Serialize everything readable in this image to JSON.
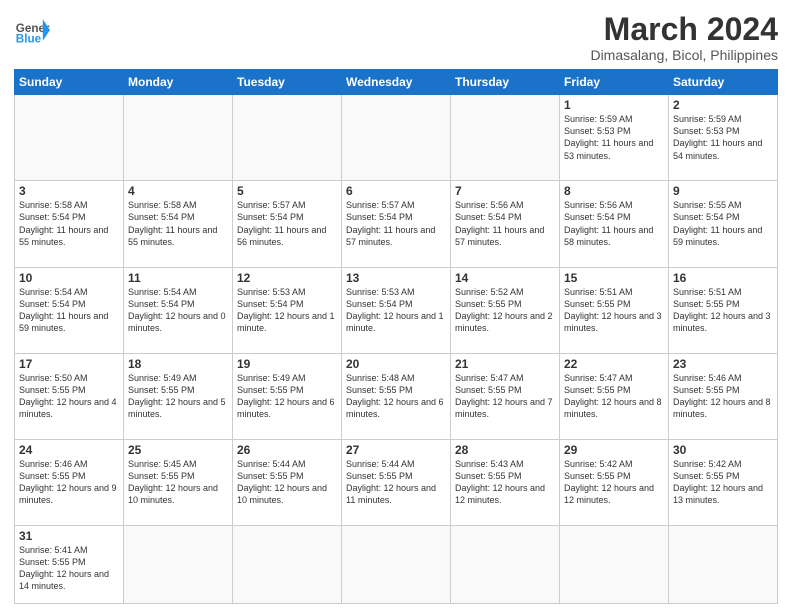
{
  "header": {
    "logo_general": "General",
    "logo_blue": "Blue",
    "month_title": "March 2024",
    "location": "Dimasalang, Bicol, Philippines"
  },
  "weekdays": [
    "Sunday",
    "Monday",
    "Tuesday",
    "Wednesday",
    "Thursday",
    "Friday",
    "Saturday"
  ],
  "rows": [
    [
      {
        "day": "",
        "info": ""
      },
      {
        "day": "",
        "info": ""
      },
      {
        "day": "",
        "info": ""
      },
      {
        "day": "",
        "info": ""
      },
      {
        "day": "",
        "info": ""
      },
      {
        "day": "1",
        "info": "Sunrise: 5:59 AM\nSunset: 5:53 PM\nDaylight: 11 hours\nand 53 minutes."
      },
      {
        "day": "2",
        "info": "Sunrise: 5:59 AM\nSunset: 5:53 PM\nDaylight: 11 hours\nand 54 minutes."
      }
    ],
    [
      {
        "day": "3",
        "info": "Sunrise: 5:58 AM\nSunset: 5:54 PM\nDaylight: 11 hours\nand 55 minutes."
      },
      {
        "day": "4",
        "info": "Sunrise: 5:58 AM\nSunset: 5:54 PM\nDaylight: 11 hours\nand 55 minutes."
      },
      {
        "day": "5",
        "info": "Sunrise: 5:57 AM\nSunset: 5:54 PM\nDaylight: 11 hours\nand 56 minutes."
      },
      {
        "day": "6",
        "info": "Sunrise: 5:57 AM\nSunset: 5:54 PM\nDaylight: 11 hours\nand 57 minutes."
      },
      {
        "day": "7",
        "info": "Sunrise: 5:56 AM\nSunset: 5:54 PM\nDaylight: 11 hours\nand 57 minutes."
      },
      {
        "day": "8",
        "info": "Sunrise: 5:56 AM\nSunset: 5:54 PM\nDaylight: 11 hours\nand 58 minutes."
      },
      {
        "day": "9",
        "info": "Sunrise: 5:55 AM\nSunset: 5:54 PM\nDaylight: 11 hours\nand 59 minutes."
      }
    ],
    [
      {
        "day": "10",
        "info": "Sunrise: 5:54 AM\nSunset: 5:54 PM\nDaylight: 11 hours\nand 59 minutes."
      },
      {
        "day": "11",
        "info": "Sunrise: 5:54 AM\nSunset: 5:54 PM\nDaylight: 12 hours\nand 0 minutes."
      },
      {
        "day": "12",
        "info": "Sunrise: 5:53 AM\nSunset: 5:54 PM\nDaylight: 12 hours\nand 1 minute."
      },
      {
        "day": "13",
        "info": "Sunrise: 5:53 AM\nSunset: 5:54 PM\nDaylight: 12 hours\nand 1 minute."
      },
      {
        "day": "14",
        "info": "Sunrise: 5:52 AM\nSunset: 5:55 PM\nDaylight: 12 hours\nand 2 minutes."
      },
      {
        "day": "15",
        "info": "Sunrise: 5:51 AM\nSunset: 5:55 PM\nDaylight: 12 hours\nand 3 minutes."
      },
      {
        "day": "16",
        "info": "Sunrise: 5:51 AM\nSunset: 5:55 PM\nDaylight: 12 hours\nand 3 minutes."
      }
    ],
    [
      {
        "day": "17",
        "info": "Sunrise: 5:50 AM\nSunset: 5:55 PM\nDaylight: 12 hours\nand 4 minutes."
      },
      {
        "day": "18",
        "info": "Sunrise: 5:49 AM\nSunset: 5:55 PM\nDaylight: 12 hours\nand 5 minutes."
      },
      {
        "day": "19",
        "info": "Sunrise: 5:49 AM\nSunset: 5:55 PM\nDaylight: 12 hours\nand 6 minutes."
      },
      {
        "day": "20",
        "info": "Sunrise: 5:48 AM\nSunset: 5:55 PM\nDaylight: 12 hours\nand 6 minutes."
      },
      {
        "day": "21",
        "info": "Sunrise: 5:47 AM\nSunset: 5:55 PM\nDaylight: 12 hours\nand 7 minutes."
      },
      {
        "day": "22",
        "info": "Sunrise: 5:47 AM\nSunset: 5:55 PM\nDaylight: 12 hours\nand 8 minutes."
      },
      {
        "day": "23",
        "info": "Sunrise: 5:46 AM\nSunset: 5:55 PM\nDaylight: 12 hours\nand 8 minutes."
      }
    ],
    [
      {
        "day": "24",
        "info": "Sunrise: 5:46 AM\nSunset: 5:55 PM\nDaylight: 12 hours\nand 9 minutes."
      },
      {
        "day": "25",
        "info": "Sunrise: 5:45 AM\nSunset: 5:55 PM\nDaylight: 12 hours\nand 10 minutes."
      },
      {
        "day": "26",
        "info": "Sunrise: 5:44 AM\nSunset: 5:55 PM\nDaylight: 12 hours\nand 10 minutes."
      },
      {
        "day": "27",
        "info": "Sunrise: 5:44 AM\nSunset: 5:55 PM\nDaylight: 12 hours\nand 11 minutes."
      },
      {
        "day": "28",
        "info": "Sunrise: 5:43 AM\nSunset: 5:55 PM\nDaylight: 12 hours\nand 12 minutes."
      },
      {
        "day": "29",
        "info": "Sunrise: 5:42 AM\nSunset: 5:55 PM\nDaylight: 12 hours\nand 12 minutes."
      },
      {
        "day": "30",
        "info": "Sunrise: 5:42 AM\nSunset: 5:55 PM\nDaylight: 12 hours\nand 13 minutes."
      }
    ],
    [
      {
        "day": "31",
        "info": "Sunrise: 5:41 AM\nSunset: 5:55 PM\nDaylight: 12 hours\nand 14 minutes."
      },
      {
        "day": "",
        "info": ""
      },
      {
        "day": "",
        "info": ""
      },
      {
        "day": "",
        "info": ""
      },
      {
        "day": "",
        "info": ""
      },
      {
        "day": "",
        "info": ""
      },
      {
        "day": "",
        "info": ""
      }
    ]
  ]
}
